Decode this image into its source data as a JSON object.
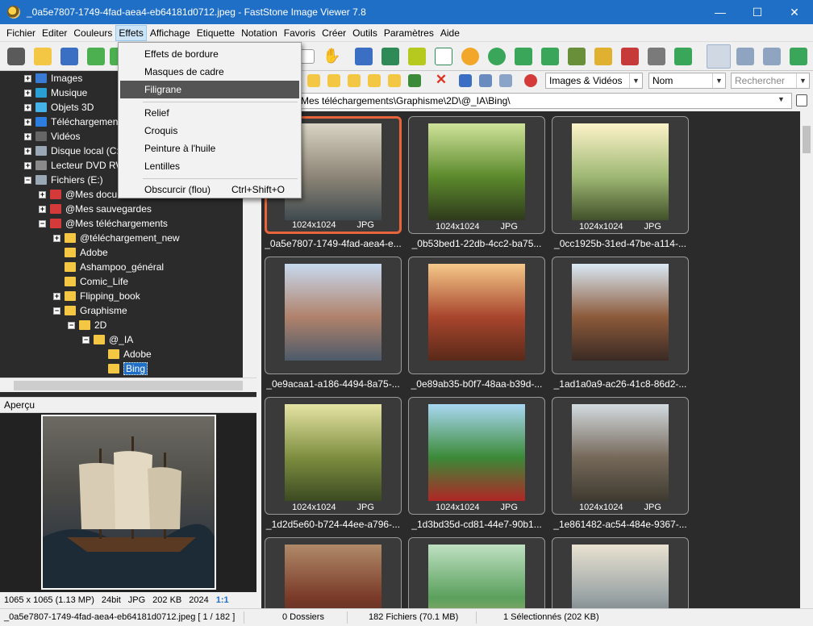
{
  "window": {
    "title": "_0a5e7807-1749-4fad-aea4-eb64181d0712.jpeg  -  FastStone Image Viewer 7.8",
    "minimize": "—",
    "maximize": "☐",
    "close": "✕"
  },
  "menubar": [
    "Fichier",
    "Editer",
    "Couleurs",
    "Effets",
    "Affichage",
    "Etiquette",
    "Notation",
    "Favoris",
    "Créer",
    "Outils",
    "Paramètres",
    "Aide"
  ],
  "effets_menu": {
    "items": [
      "Effets de bordure",
      "Masques de cadre",
      "Filigrane",
      "Relief",
      "Croquis",
      "Peinture à l'huile",
      "Lentilles",
      "Obscurcir (flou)"
    ],
    "highlighted": "Filigrane",
    "shortcut": "Ctrl+Shift+O"
  },
  "tree": {
    "items": [
      {
        "label": "Images",
        "icon": "pictures-icon",
        "color": "#3a7bd5"
      },
      {
        "label": "Musique",
        "icon": "music-icon",
        "color": "#2a9fd6"
      },
      {
        "label": "Objets 3D",
        "icon": "3d-objects-icon",
        "color": "#45b3e7"
      },
      {
        "label": "Téléchargements",
        "icon": "download-icon",
        "color": "#2c7de0"
      },
      {
        "label": "Vidéos",
        "icon": "video-icon",
        "color": "#666666"
      },
      {
        "label": "Disque local (C:)",
        "icon": "drive-icon",
        "color": "#9aa7b4"
      },
      {
        "label": "Lecteur DVD RW",
        "icon": "dvd-drive-icon",
        "color": "#8a8a8a"
      },
      {
        "label": "Fichiers (E:)",
        "icon": "drive-icon",
        "color": "#9aa7b4"
      },
      {
        "label": "@Mes documents",
        "icon": "folder-icon",
        "color": "#d43a3a"
      },
      {
        "label": "@Mes sauvegardes",
        "icon": "folder-icon",
        "color": "#d43a3a"
      },
      {
        "label": "@Mes téléchargements",
        "icon": "folder-icon",
        "color": "#d43a3a"
      },
      {
        "label": "@téléchargement_new",
        "icon": "folder-icon",
        "color": "#f3c744"
      },
      {
        "label": "Adobe",
        "icon": "folder-icon",
        "color": "#f3c744"
      },
      {
        "label": "Ashampoo_général",
        "icon": "folder-icon",
        "color": "#f3c744"
      },
      {
        "label": "Comic_Life",
        "icon": "folder-icon",
        "color": "#f3c744"
      },
      {
        "label": "Flipping_book",
        "icon": "folder-icon",
        "color": "#f3c744"
      },
      {
        "label": "Graphisme",
        "icon": "folder-icon",
        "color": "#f3c744"
      },
      {
        "label": "2D",
        "icon": "folder-icon",
        "color": "#f3c744"
      },
      {
        "label": "@_IA",
        "icon": "folder-icon",
        "color": "#f3c744"
      },
      {
        "label": "Adobe",
        "icon": "folder-icon",
        "color": "#f3c744"
      },
      {
        "label": "Bing",
        "icon": "folder-icon",
        "color": "#f3c744"
      }
    ]
  },
  "preview": {
    "header": "Aperçu",
    "info": [
      "1065 x 1065 (1.13 MP)",
      "24bit",
      "JPG",
      "202 KB",
      "2024",
      "1:1"
    ]
  },
  "filters": {
    "type": "Images & Vidéos",
    "sort": "Nom",
    "search_placeholder": "Rechercher"
  },
  "path": "Mes téléchargements\\Graphisme\\2D\\@_IA\\Bing\\",
  "thumbnails": [
    {
      "name": "_0a5e7807-1749-4fad-aea4-e...",
      "size": "1024x1024",
      "format": "JPG",
      "selected": true,
      "palette": [
        "#d9d4c4",
        "#8d8577",
        "#3f4a4e"
      ]
    },
    {
      "name": "_0b53bed1-22db-4cc2-ba75...",
      "size": "1024x1024",
      "format": "JPG",
      "palette": [
        "#cfe39a",
        "#5c8a2c",
        "#2f3a1c"
      ]
    },
    {
      "name": "_0cc1925b-31ed-47be-a114-...",
      "size": "1024x1024",
      "format": "JPG",
      "palette": [
        "#fdf3c9",
        "#9fb874",
        "#42512a"
      ]
    },
    {
      "name": "_0e9acaa1-a186-4494-8a75-...",
      "size": "",
      "format": "",
      "palette": [
        "#c7d9ef",
        "#b0826b",
        "#4c5a6a"
      ]
    },
    {
      "name": "_0e89ab35-b0f7-48aa-b39d-...",
      "size": "",
      "format": "",
      "palette": [
        "#f5c98a",
        "#a8452d",
        "#5a2a19"
      ]
    },
    {
      "name": "_1ad1a0a9-ac26-41c8-86d2-...",
      "size": "",
      "format": "",
      "palette": [
        "#d9e9f5",
        "#8c5a3a",
        "#3a2a24"
      ]
    },
    {
      "name": "_1d2d5e60-b724-44ee-a796-...",
      "size": "1024x1024",
      "format": "JPG",
      "palette": [
        "#e6e4a4",
        "#7d8e3f",
        "#3c4a22"
      ]
    },
    {
      "name": "_1d3bd35d-cd81-44e7-90b1...",
      "size": "1024x1024",
      "format": "JPG",
      "palette": [
        "#a9d8f3",
        "#3b8a38",
        "#b02626"
      ]
    },
    {
      "name": "_1e861482-ac54-484e-9367-...",
      "size": "1024x1024",
      "format": "JPG",
      "palette": [
        "#d3dbe0",
        "#76695a",
        "#3e3a30"
      ]
    },
    {
      "name": "",
      "size": "",
      "format": "",
      "palette": [
        "#b08a6a",
        "#7a3a28",
        "#3c2a24"
      ]
    },
    {
      "name": "",
      "size": "",
      "format": "",
      "palette": [
        "#bfe0c2",
        "#5aa05c",
        "#d0b27a"
      ]
    },
    {
      "name": "",
      "size": "",
      "format": "",
      "palette": [
        "#e9e2d1",
        "#9aa3a5",
        "#4a5254"
      ]
    }
  ],
  "status": {
    "file": "_0a5e7807-1749-4fad-aea4-eb64181d0712.jpeg [ 1 / 182 ]",
    "folders": "0 Dossiers",
    "files": "182 Fichiers (70.1 MB)",
    "selected": "1 Sélectionnés (202 KB)"
  }
}
